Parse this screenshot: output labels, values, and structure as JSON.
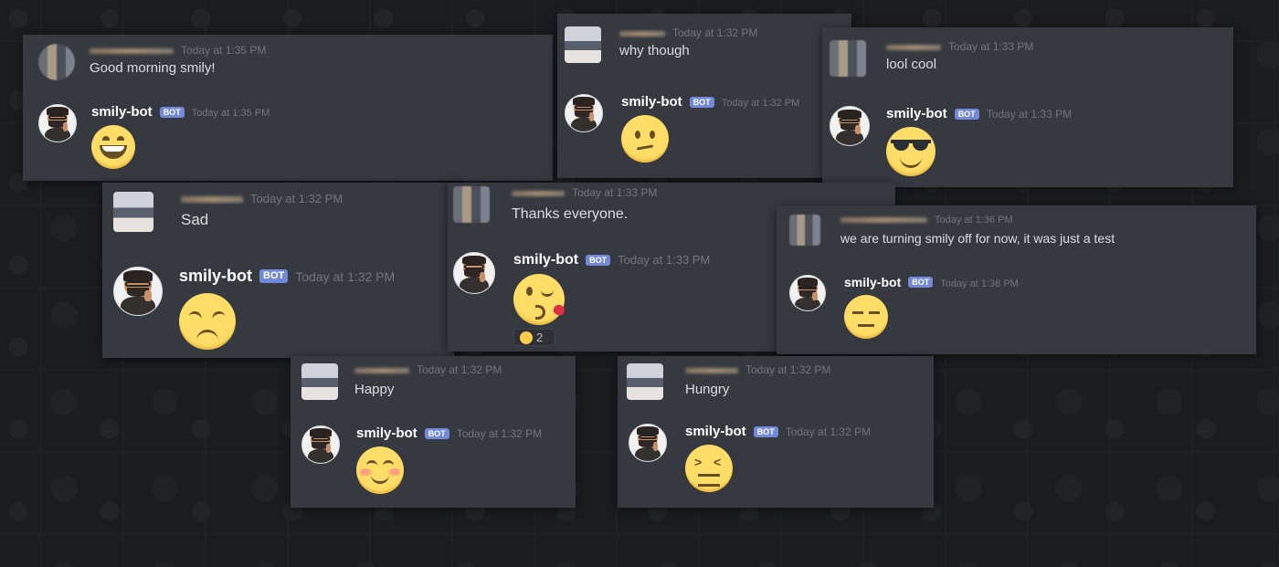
{
  "bot": {
    "name": "smily-bot",
    "badge": "BOT"
  },
  "cards": {
    "c1": {
      "user_ts": "Today at 1:35 PM",
      "user_text": "Good morning smily!",
      "bot_ts": "Today at 1:35 PM",
      "emoji": "grinning-face-with-big-eyes"
    },
    "c2": {
      "user_ts": "Today at 1:32 PM",
      "user_text": "why though",
      "bot_ts": "Today at 1:32 PM",
      "emoji": "confused-face"
    },
    "c3": {
      "user_ts": "Today at 1:33 PM",
      "user_text": "lool cool",
      "bot_ts": "Today at 1:33 PM",
      "emoji": "smiling-face-with-sunglasses"
    },
    "c4": {
      "user_ts": "Today at 1:32 PM",
      "user_text": "Sad",
      "bot_ts": "Today at 1:32 PM",
      "emoji": "disappointed-face"
    },
    "c5": {
      "user_ts": "Today at 1:33 PM",
      "user_text": "Thanks everyone.",
      "bot_ts": "Today at 1:33 PM",
      "emoji": "face-blowing-a-kiss",
      "reaction": {
        "emoji": "rolling-on-the-floor-laughing",
        "count": "2"
      }
    },
    "c6": {
      "user_ts": "Today at 1:36 PM",
      "user_text": "we are turning smily off for now, it was just a test",
      "bot_ts": "Today at 1:36 PM",
      "emoji": "expressionless-face"
    },
    "c7": {
      "user_ts": "Today at 1:32 PM",
      "user_text": "Happy",
      "bot_ts": "Today at 1:32 PM",
      "emoji": "smiling-face-with-smiling-eyes"
    },
    "c8": {
      "user_ts": "Today at 1:32 PM",
      "user_text": "Hungry",
      "bot_ts": "Today at 1:32 PM",
      "emoji": "confounded-face"
    }
  },
  "colors": {
    "card_bg": "#36393f",
    "badge": "#7289da",
    "timestamp": "#72767d",
    "emoji_yellow": "#ffcc4d"
  }
}
